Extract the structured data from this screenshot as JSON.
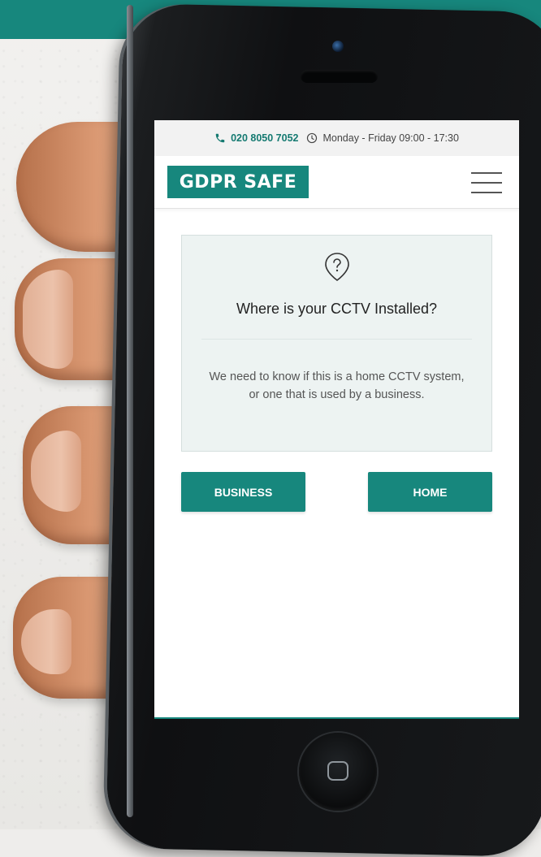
{
  "topbar": {
    "phone": "020 8050 7052",
    "phone_icon": "phone-icon",
    "hours": "Monday - Friday 09:00 - 17:30",
    "hours_icon": "clock-icon"
  },
  "header": {
    "logo": "GDPR SAFE",
    "menu_icon": "hamburger-menu-icon"
  },
  "card": {
    "icon": "location-question-icon",
    "title": "Where is your CCTV Installed?",
    "description": "We need to know if this is a home CCTV system, or one that is used by a business."
  },
  "buttons": {
    "business": "BUSINESS",
    "home": "HOME"
  },
  "colors": {
    "brand_teal": "#17877d",
    "card_bg": "#edf3f2"
  }
}
